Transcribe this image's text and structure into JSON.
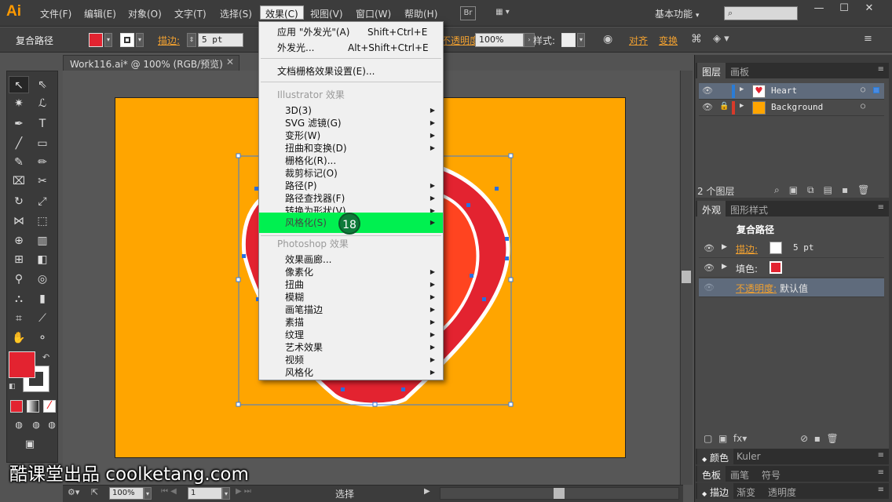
{
  "app": {
    "logo": "Ai"
  },
  "menubar": {
    "items": [
      "文件(F)",
      "编辑(E)",
      "对象(O)",
      "文字(T)",
      "选择(S)",
      "效果(C)",
      "视图(V)",
      "窗口(W)",
      "帮助(H)"
    ],
    "bridge_label": "Br",
    "workspace": "基本功能",
    "window_controls": [
      "—",
      "☐",
      "✕"
    ]
  },
  "controlbar": {
    "object_type": "复合路径",
    "stroke_label": "描边:",
    "stroke_value": "5 pt",
    "opacity_label": "不透明度:",
    "opacity_value": "100%",
    "style_label": "样式:",
    "align_label": "对齐",
    "transform_label": "变换"
  },
  "document": {
    "tab_title": "Work116.ai* @ 100% (RGB/预览)",
    "close": "✕"
  },
  "effect_menu": {
    "apply_last": "应用 \"外发光\"(A)",
    "apply_last_shortcut": "Shift+Ctrl+E",
    "last_effect": "外发光...",
    "last_effect_shortcut": "Alt+Shift+Ctrl+E",
    "raster_settings": "文档栅格效果设置(E)...",
    "illustrator_header": "Illustrator 效果",
    "illustrator_items": [
      "3D(3)",
      "SVG 滤镜(G)",
      "变形(W)",
      "扭曲和变换(D)",
      "栅格化(R)...",
      "裁剪标记(O)",
      "路径(P)",
      "路径查找器(F)",
      "转换为形状(V)"
    ],
    "highlighted_item": "风格化(S)",
    "photoshop_header": "Photoshop 效果",
    "photoshop_items": [
      "效果画廊...",
      "像素化",
      "扭曲",
      "模糊",
      "画笔描边",
      "素描",
      "纹理",
      "艺术效果",
      "视频",
      "风格化"
    ]
  },
  "step_badge": "18",
  "layers_panel": {
    "tabs": [
      "图层",
      "画板"
    ],
    "layers": [
      {
        "name": "Heart",
        "color": "#2a7cd6"
      },
      {
        "name": "Background",
        "color": "#d83a2a"
      }
    ],
    "count": "2 个图层"
  },
  "appearance_panel": {
    "tabs": [
      "外观",
      "图形样式"
    ],
    "title": "复合路径",
    "stroke_label": "描边:",
    "stroke_value": "5 pt",
    "fill_label": "填色:",
    "opacity_label": "不透明度:",
    "opacity_value": "默认值"
  },
  "collapsed_panels": [
    {
      "tabs": [
        "颜色",
        "Kuler"
      ]
    },
    {
      "tabs": [
        "色板",
        "画笔",
        "符号"
      ]
    },
    {
      "tabs": [
        "描边",
        "渐变",
        "透明度"
      ]
    }
  ],
  "statusbar": {
    "zoom": "100%",
    "page": "1",
    "tool_name": "选择"
  },
  "colors": {
    "artboard": "#ffa500",
    "heart_outer": "#e32330",
    "heart_inner": "#ff4420",
    "fill_swatch": "#e32330",
    "menu_highlight": "#00f050"
  },
  "watermark": "酷课堂出品 coolketang.com"
}
